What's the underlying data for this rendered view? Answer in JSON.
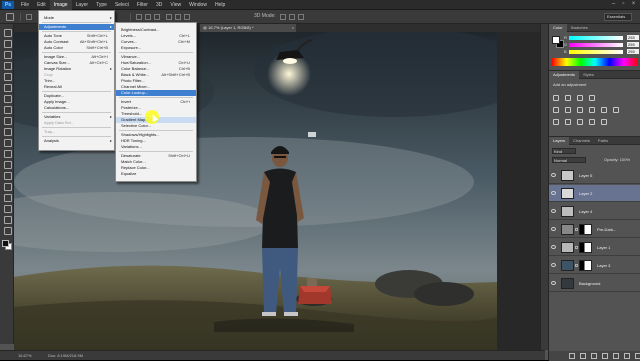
{
  "menubar": {
    "logo": "Ps",
    "items": [
      "File",
      "Edit",
      "Image",
      "Layer",
      "Type",
      "Select",
      "Filter",
      "3D",
      "View",
      "Window",
      "Help"
    ],
    "active_item": "Image"
  },
  "optionsbar": {
    "mode3d": "3D Mode:",
    "workspace": "Essentials"
  },
  "document": {
    "tab_title": "@ 16.7% (Layer 1, RGB/8) *",
    "status_zoom": "16.67%",
    "status_doc": "Doc: 8.19M/218.9M"
  },
  "image_menu": {
    "items": [
      {
        "label": "Mode",
        "arrow": "▸",
        "state": "normal"
      },
      {
        "sep": true
      },
      {
        "label": "Adjustments",
        "arrow": "▸",
        "state": "highlight"
      },
      {
        "sep": true
      },
      {
        "label": "Auto Tone",
        "shortcut": "Shift+Ctrl+L",
        "state": "normal"
      },
      {
        "label": "Auto Contrast",
        "shortcut": "Alt+Shift+Ctrl+L",
        "state": "normal"
      },
      {
        "label": "Auto Color",
        "shortcut": "Shift+Ctrl+B",
        "state": "normal"
      },
      {
        "sep": true
      },
      {
        "label": "Image Size...",
        "shortcut": "Alt+Ctrl+I",
        "state": "normal"
      },
      {
        "label": "Canvas Size...",
        "shortcut": "Alt+Ctrl+C",
        "state": "normal"
      },
      {
        "label": "Image Rotation",
        "arrow": "▸",
        "state": "normal"
      },
      {
        "label": "Crop",
        "state": "disabled"
      },
      {
        "label": "Trim...",
        "state": "normal"
      },
      {
        "label": "Reveal All",
        "state": "normal"
      },
      {
        "sep": true
      },
      {
        "label": "Duplicate...",
        "state": "normal"
      },
      {
        "label": "Apply Image...",
        "state": "normal"
      },
      {
        "label": "Calculations...",
        "state": "normal"
      },
      {
        "sep": true
      },
      {
        "label": "Variables",
        "arrow": "▸",
        "state": "normal"
      },
      {
        "label": "Apply Data Set...",
        "state": "disabled"
      },
      {
        "sep": true
      },
      {
        "label": "Trap...",
        "state": "disabled"
      },
      {
        "sep": true
      },
      {
        "label": "Analysis",
        "arrow": "▸",
        "state": "normal"
      }
    ]
  },
  "adjustments_menu": {
    "items": [
      {
        "label": "Brightness/Contrast...",
        "state": "normal"
      },
      {
        "label": "Levels...",
        "shortcut": "Ctrl+L",
        "state": "normal"
      },
      {
        "label": "Curves...",
        "shortcut": "Ctrl+M",
        "state": "normal"
      },
      {
        "label": "Exposure...",
        "state": "normal"
      },
      {
        "sep": true
      },
      {
        "label": "Vibrance...",
        "state": "normal"
      },
      {
        "label": "Hue/Saturation...",
        "shortcut": "Ctrl+U",
        "state": "normal"
      },
      {
        "label": "Color Balance...",
        "shortcut": "Ctrl+B",
        "state": "normal"
      },
      {
        "label": "Black & White...",
        "shortcut": "Alt+Shift+Ctrl+B",
        "state": "normal"
      },
      {
        "label": "Photo Filter...",
        "state": "normal"
      },
      {
        "label": "Channel Mixer...",
        "state": "normal"
      },
      {
        "label": "Color Lookup...",
        "state": "highlight"
      },
      {
        "sep": true
      },
      {
        "label": "Invert",
        "shortcut": "Ctrl+I",
        "state": "normal"
      },
      {
        "label": "Posterize...",
        "state": "normal"
      },
      {
        "label": "Threshold...",
        "state": "normal"
      },
      {
        "label": "Gradient Map...",
        "state": "hover"
      },
      {
        "label": "Selective Color...",
        "state": "normal"
      },
      {
        "sep": true
      },
      {
        "label": "Shadows/Highlights...",
        "state": "normal"
      },
      {
        "label": "HDR Toning...",
        "state": "normal"
      },
      {
        "label": "Variations...",
        "state": "normal"
      },
      {
        "sep": true
      },
      {
        "label": "Desaturate",
        "shortcut": "Shift+Ctrl+U",
        "state": "normal"
      },
      {
        "label": "Match Color...",
        "state": "normal"
      },
      {
        "label": "Replace Color...",
        "state": "normal"
      },
      {
        "label": "Equalize",
        "state": "normal"
      }
    ]
  },
  "color_panel": {
    "tabs": [
      "Color",
      "Swatches"
    ],
    "channels": [
      {
        "label": "R",
        "value": "255"
      },
      {
        "label": "G",
        "value": "255"
      },
      {
        "label": "B",
        "value": "255"
      }
    ],
    "foreground": "#ffffff",
    "background": "#000000"
  },
  "adjustments_panel": {
    "tabs": [
      "Adjustments",
      "Styles"
    ],
    "header": "Add an adjustment"
  },
  "layers_panel": {
    "tabs": [
      "Layers",
      "Channels",
      "Paths"
    ],
    "kind": "Kind",
    "blend": "Normal",
    "opacity_label": "Opacity:",
    "opacity": "100%",
    "fill_label": "Fill:",
    "fill": "100%",
    "layers": [
      {
        "name": "Layer 5",
        "selected": false,
        "thumb": "#c9c9c9",
        "mask": false
      },
      {
        "name": "Layer 2",
        "selected": true,
        "thumb": "#d9d9d9",
        "mask": false
      },
      {
        "name": "Layer 4",
        "selected": false,
        "thumb": "#bdbdbd",
        "mask": false
      },
      {
        "name": "Pre-Dark...",
        "selected": false,
        "thumb": "#888888",
        "mask": true
      },
      {
        "name": "Layer 1",
        "selected": false,
        "thumb": "#b8b8b8",
        "mask": true
      },
      {
        "name": "Layer 3",
        "selected": false,
        "thumb": "#3d5466",
        "mask": true
      },
      {
        "name": "Background",
        "selected": false,
        "thumb": "#333a3f",
        "mask": false
      }
    ]
  },
  "colors": {
    "menu_highlight": "#3f7fd0",
    "selected_layer": "#677390"
  }
}
